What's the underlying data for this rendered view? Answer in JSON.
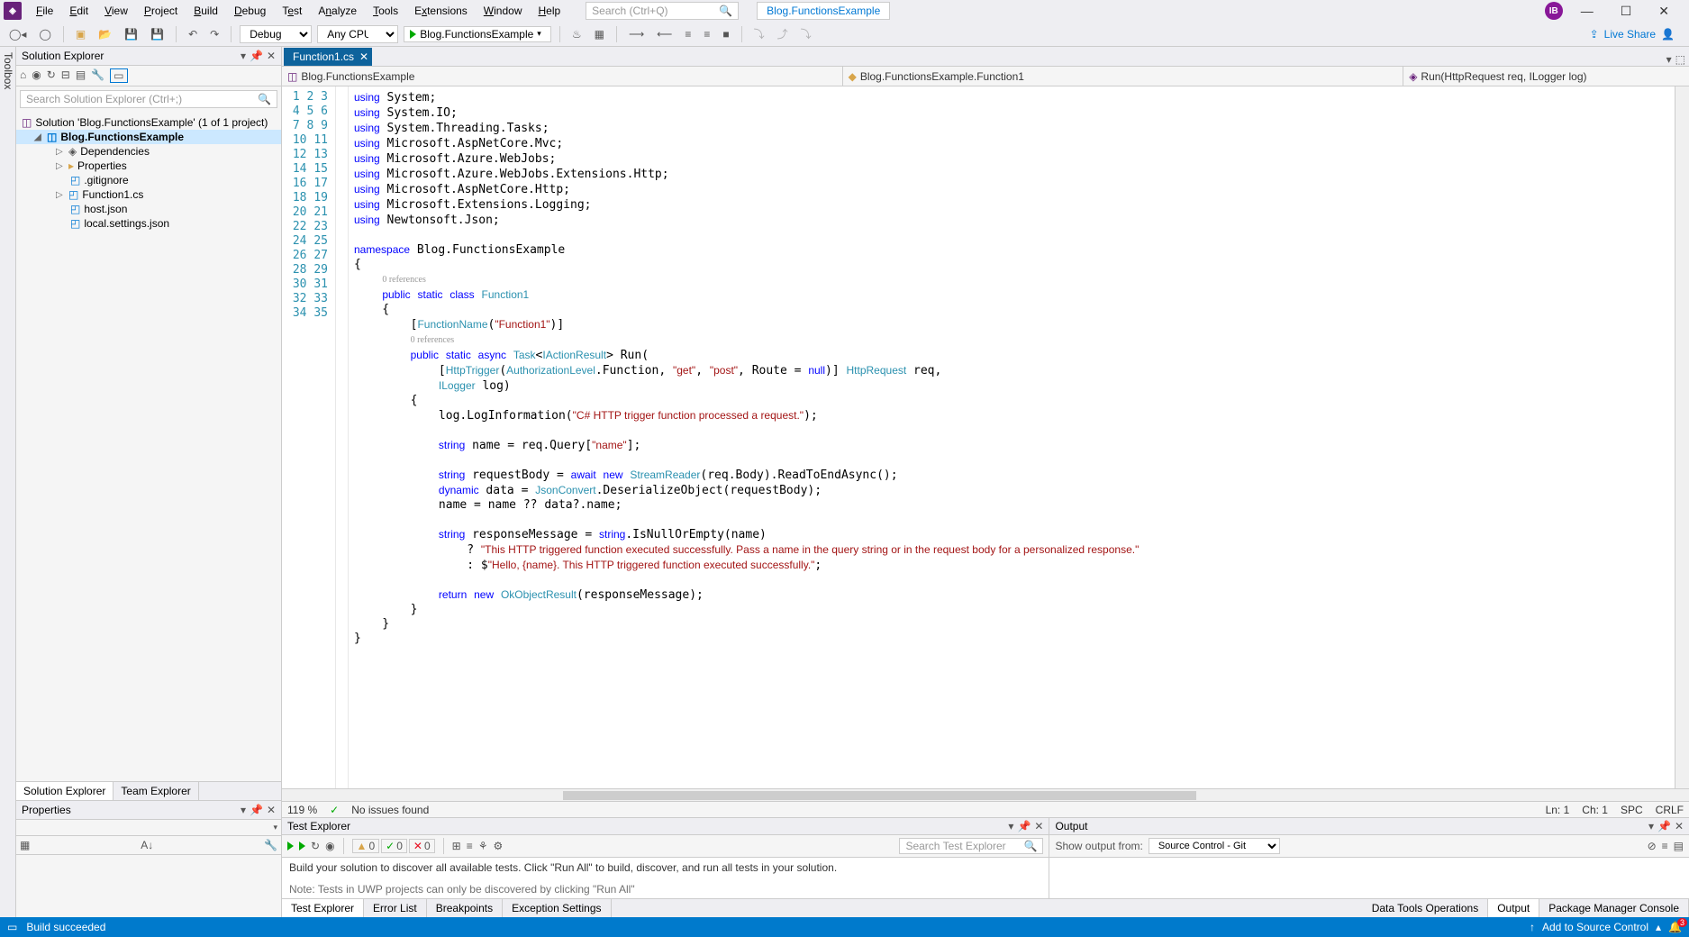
{
  "titlebar": {
    "menus": [
      "File",
      "Edit",
      "View",
      "Project",
      "Build",
      "Debug",
      "Test",
      "Analyze",
      "Tools",
      "Extensions",
      "Window",
      "Help"
    ],
    "search_placeholder": "Search (Ctrl+Q)",
    "project_name": "Blog.FunctionsExample",
    "avatar_initials": "IB"
  },
  "toolbar": {
    "config": "Debug",
    "platform": "Any CPU",
    "start_target": "Blog.FunctionsExample",
    "liveshare": "Live Share"
  },
  "toolbox_tab": "Toolbox",
  "solution_explorer": {
    "title": "Solution Explorer",
    "search_placeholder": "Search Solution Explorer (Ctrl+;)",
    "solution_label": "Solution 'Blog.FunctionsExample' (1 of 1 project)",
    "project": "Blog.FunctionsExample",
    "items": [
      "Dependencies",
      "Properties",
      ".gitignore",
      "Function1.cs",
      "host.json",
      "local.settings.json"
    ],
    "tabs": [
      "Solution Explorer",
      "Team Explorer"
    ]
  },
  "properties": {
    "title": "Properties"
  },
  "editor": {
    "tab": "Function1.cs",
    "nav_left": "Blog.FunctionsExample",
    "nav_middle": "Blog.FunctionsExample.Function1",
    "nav_right": "Run(HttpRequest req, ILogger log)",
    "zoom": "119 %",
    "issues": "No issues found",
    "ln": "Ln: 1",
    "ch": "Ch: 1",
    "spc": "SPC",
    "crlf": "CRLF",
    "ref_text": "0 references"
  },
  "test_explorer": {
    "title": "Test Explorer",
    "counts": {
      "warn": "0",
      "pass": "0",
      "fail": "0"
    },
    "search_placeholder": "Search Test Explorer",
    "line1": "Build your solution to discover all available tests. Click \"Run All\" to build, discover, and run all tests in your solution.",
    "line2": "Note: Tests in UWP projects can only be discovered by clicking \"Run All\""
  },
  "output": {
    "title": "Output",
    "label": "Show output from:",
    "source": "Source Control - Git"
  },
  "bottom_tabs_left": [
    "Test Explorer",
    "Error List",
    "Breakpoints",
    "Exception Settings"
  ],
  "bottom_tabs_right": [
    "Data Tools Operations",
    "Output",
    "Package Manager Console"
  ],
  "statusbar": {
    "build": "Build succeeded",
    "add_source": "Add to Source Control",
    "notif_count": "3"
  }
}
